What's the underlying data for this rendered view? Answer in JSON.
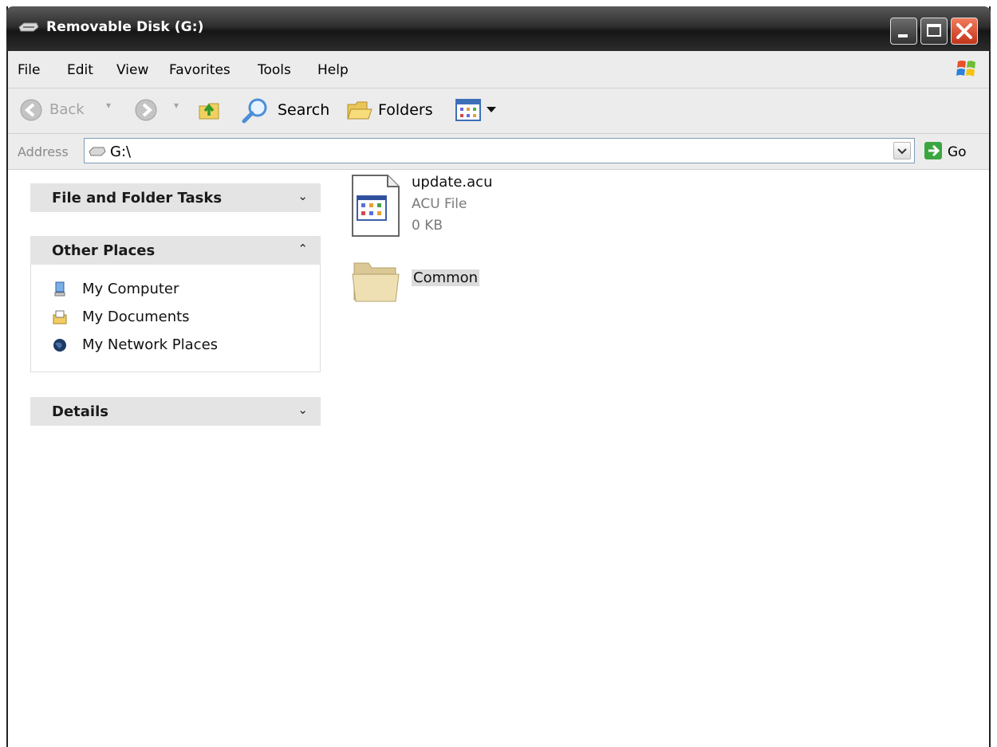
{
  "window": {
    "title": "Removable Disk (G:)"
  },
  "menu": {
    "items": [
      "File",
      "Edit",
      "View",
      "Favorites",
      "Tools",
      "Help"
    ]
  },
  "toolbar": {
    "back_label": "Back",
    "search_label": "Search",
    "folders_label": "Folders"
  },
  "address": {
    "label": "Address",
    "value": "G:\\",
    "go_label": "Go"
  },
  "tasks": {
    "file_folder_tasks": "File and Folder Tasks",
    "other_places": {
      "title": "Other Places",
      "items": [
        "My Computer",
        "My Documents",
        "My Network Places"
      ]
    },
    "details": "Details"
  },
  "files": [
    {
      "name": "update.acu",
      "type": "ACU File",
      "size": "0 KB",
      "icon": "acu-file-icon"
    },
    {
      "name": "Common",
      "icon": "folder-icon"
    }
  ]
}
